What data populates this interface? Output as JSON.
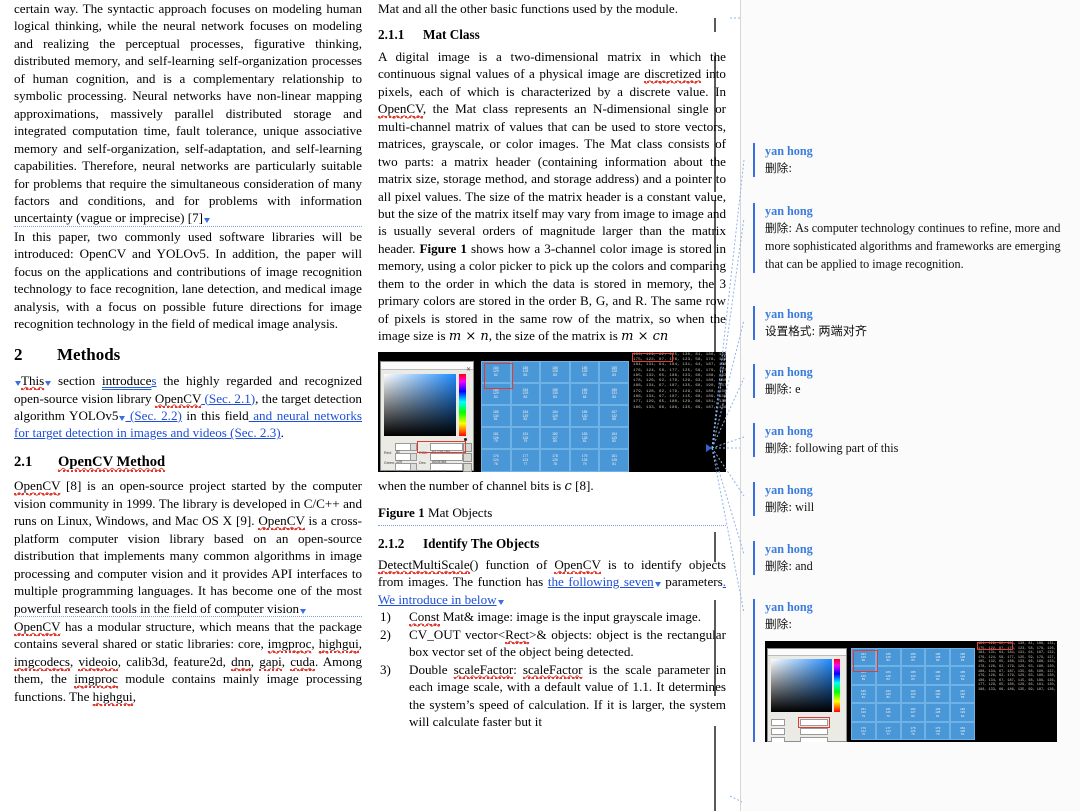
{
  "document": {
    "left_column": {
      "para1": "certain way. The syntactic approach focuses on modeling human logical thinking, while the neural network focuses on modeling and realizing the perceptual processes, figurative thinking, distributed memory, and self-learning self-organization processes of human cognition, and is a complementary relationship to symbolic processing. Neural networks have non-linear mapping approximations, massively parallel distributed storage and integrated computation time, fault tolerance, unique associative memory and self-organization, self-adaptation, and self-learning capabilities. Therefore, neural networks are particularly suitable for problems that require the simultaneous consideration of many factors and conditions, and for problems with information uncertainty (vague or imprecise) [7]",
      "para2": "In this paper, two commonly used software libraries will be introduced: OpenCV and YOLOv5. In addition, the paper will focus on the applications and contributions of image recognition technology to face recognition, lane detection, and medical image analysis, with a focus on possible future directions for image recognition technology in the field of medical image analysis.",
      "heading_methods_num": "2",
      "heading_methods": "Methods",
      "methods_p_a": "This",
      "methods_p_b": " section ",
      "methods_p_c": "introduce",
      "methods_p_d": "s",
      "methods_p_e": " the highly regarded and recognized open-source vision library ",
      "methods_p_f": "OpenCV",
      "methods_p_g": " (Sec. 2.1)",
      "methods_p_h": ", the target detection algorithm YOLOv5",
      "methods_p_i": " (Sec. 2.2)",
      "methods_p_j": " in this field",
      "methods_p_k": " and neural networks for target detection in images and videos (Sec. 2.3)",
      "methods_p_l": ".",
      "heading_opencv_num": "2.1",
      "heading_opencv": "OpenCV Method",
      "opencv_p1_a": "OpenCV",
      "opencv_p1_b": " [8] is an open-source project started by the computer vision community in 1999. The library is developed in C/C++ and runs on Linux, Windows, and Mac OS X [9]. ",
      "opencv_p1_c": "OpenCV",
      "opencv_p1_d": " is a cross-platform computer vision library based on an open-source distribution that implements many common algorithms in image processing and computer vision and it provides API interfaces to multiple programming languages. It has become one of the most powerful research tools in the field of computer vision",
      "opencv_p2_a": "OpenCV",
      "opencv_p2_b": " has a modular structure, which means that the package contains several shared or static libraries: core, ",
      "opencv_p2_c": "imgproc",
      "opencv_p2_d": ", ",
      "opencv_p2_e": "highgui",
      "opencv_p2_f": ", ",
      "opencv_p2_g": "imgcodecs",
      "opencv_p2_h": ", ",
      "opencv_p2_i": "videoio",
      "opencv_p2_j": ", calib3d, feature2d, ",
      "opencv_p2_k": "dnn",
      "opencv_p2_l": ", ",
      "opencv_p2_m": "gapi",
      "opencv_p2_n": ", ",
      "opencv_p2_o": "cuda",
      "opencv_p2_p": ". Among them, the ",
      "opencv_p2_q": "imgproc",
      "opencv_p2_r": " module contains mainly image processing functions. The ",
      "opencv_p2_s": "highgui",
      "opencv_p2_t": ","
    },
    "middle_column": {
      "para_top": "Mat and all the other basic functions used by the module.",
      "heading_mat_num": "2.1.1",
      "heading_mat": "Mat Class",
      "mat_p_a": "A digital image is a two-dimensional matrix in which the continuous signal values of a physical image are ",
      "mat_p_b": "discretized",
      "mat_p_c": " into pixels, each of which is characterized by a discrete value. In ",
      "mat_p_d": "OpenCV",
      "mat_p_e": ", the Mat class represents an N-dimensional single or multi-channel matrix of values that can be used to store vectors, matrices, grayscale, or color images. The Mat class consists of two parts: a matrix header (containing information about the matrix size, storage method, and storage address) and a pointer to all pixel values. The size of the matrix header is a constant value, but the size of the matrix itself may vary from image to image and is usually several orders of magnitude larger than the matrix header. ",
      "mat_p_f": "Figure 1",
      "mat_p_g": " shows how a 3-channel color image is stored in memory, using a color picker to pick up the colors and comparing them to the order in which the data is stored in memory, the 3 primary colors are stored in the order B, G, and R. The same row of pixels is stored in the same row of the matrix, so when the image size is ",
      "mat_math1": "m × n",
      "mat_p_h": ", the size of the matrix is ",
      "mat_math2": "m × cn",
      "fig_after_a": "when the number of channel bits is ",
      "fig_after_math": "c",
      "fig_after_b": " [8].",
      "figure_caption_bold": "Figure 1",
      "figure_caption_rest": " Mat Objects",
      "heading_identify_num": "2.1.2",
      "heading_identify": "Identify The Objects",
      "identify_p_a": "DetectMultiScale",
      "identify_p_b": "() function of ",
      "identify_p_c": "OpenCV",
      "identify_p_d": " is to identify objects from images. The function has ",
      "identify_p_e": "the following seven",
      "identify_p_f": " parameters",
      "identify_p_g": ". We introduce in below",
      "list": [
        {
          "marker": "1)",
          "a": "Const",
          "b": " Mat& image: image is the input grayscale image."
        },
        {
          "marker": "2)",
          "a": "CV_OUT vector<",
          "b": "Rect",
          "c": ">& objects: object is the rectangular box vector set of the object being detected."
        },
        {
          "marker": "3)",
          "a": "Double  ",
          "b": "scaleFactor",
          "c": ":  ",
          "d": "scaleFactor",
          "e": "  is  the  scale parameter in each image scale, with a default value of 1.1. It determines the system’s speed of calculation. If it is larger, the system will calculate faster but it"
        }
      ]
    }
  },
  "figure": {
    "color_picker": {
      "labels": [
        "Red:",
        "Green:",
        "Blue:"
      ],
      "values": [
        "82",
        "129",
        "184"
      ],
      "field_labels": [
        "RGB:",
        "Dec:",
        "Hex:"
      ],
      "field_values": [
        "82 129 184",
        "#5281B8",
        "52 81 B8"
      ]
    },
    "grid_cells": [
      [
        "184\n129\n82",
        "185\n128\n83",
        "185\n128\n83",
        "185\n128\n83",
        "185\n128\n83"
      ],
      [
        "184\n129\n83",
        "184\n129\n83",
        "185\n130\n83",
        "186\n131\n84",
        "185\n131\n83"
      ],
      [
        "185\n130\n81",
        "184\n129\n82",
        "184\n129\n82",
        "185\n130\n83",
        "187\n132\n85"
      ],
      [
        "181\n126\n79",
        "181\n126\n79",
        "182\n127\n80",
        "183\n128\n81",
        "184\n129\n82"
      ],
      [
        "176\n124\n76",
        "177\n124\n77",
        "178\n125\n78",
        "179\n126\n79",
        "181\n128\n81"
      ]
    ],
    "terminal_lines": [
      "184, 129,  82, 185, 130,  81, 186, 131,  82,",
      "175, 122,  87, 176, 123,  58, 178, 126,  60,",
      "184, 131,  64, 184, 131,  64, 187, 132,  63,",
      "176, 124,  58, 177, 125,  59, 179, 127,  61,",
      "185, 132,  65, 186, 133,  66, 188, 133,  64,",
      "178, 126,  62, 179, 129,  63, 180, 130,  64,",
      "188, 134,  67, 187, 135,  68, 190, 137,  70,",
      "179, 128,  62, 179, 129,  63, 180, 130,  61,",
      "186, 134,  67, 187, 115,  68, 189, 136,  69,",
      "177, 129,  65, 180, 129,  66, 181, 130,  67,",
      "186, 133,  66, 186, 135,  69, 187, 136,  66,"
    ],
    "red_highlight_terminal": "184, 129,  82,"
  },
  "markup_pane": {
    "balloons": [
      {
        "author": "yan hong",
        "label": "删除:",
        "text": ""
      },
      {
        "author": "yan hong",
        "label": "删除:",
        "text": " As computer technology continues to refine, more and more sophisticated algorithms and frameworks are emerging that can be applied to image recognition."
      },
      {
        "author": "yan hong",
        "label": "设置格式:",
        "text": " 两端对齐"
      },
      {
        "author": "yan hong",
        "label": "删除:",
        "text": " e"
      },
      {
        "author": "yan hong",
        "label": "删除:",
        "text": " following part of this"
      },
      {
        "author": "yan hong",
        "label": "删除:",
        "text": " will"
      },
      {
        "author": "yan hong",
        "label": "删除:",
        "text": "  and"
      },
      {
        "author": "yan hong",
        "label": "删除:",
        "text": ""
      }
    ]
  },
  "colors": {
    "revision_author": "#3b7ddd",
    "insertion": "#1f4fd8",
    "spelling_underline": "#e24a3b",
    "changed_line_bar": "#5a5a5a",
    "balloon_border": "#3b6fe0",
    "pane_background": "#fbfbfb"
  }
}
